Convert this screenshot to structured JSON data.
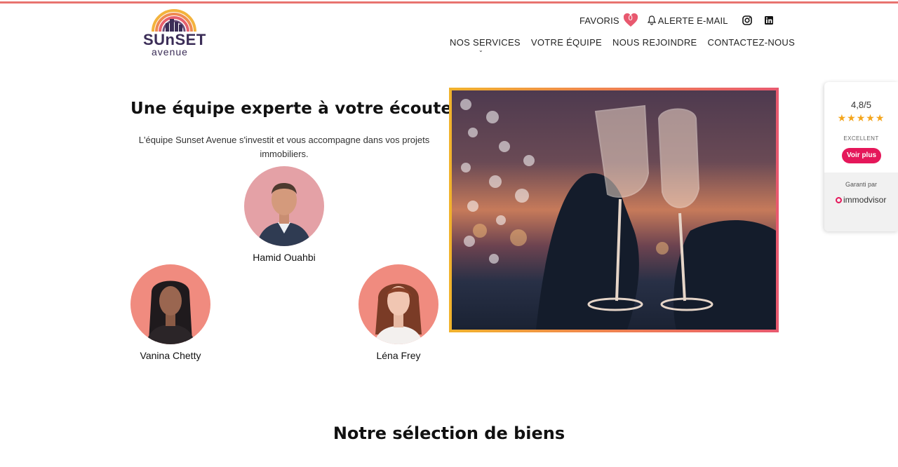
{
  "header": {
    "logo": {
      "line1": "SUnSET",
      "line2": "avenue"
    },
    "utility": {
      "favoris_label": "FAVORIS",
      "favoris_count": "0",
      "alert_label": "ALERTE E-MAIL",
      "social": [
        "instagram-icon",
        "linkedin-icon"
      ]
    },
    "nav": [
      {
        "label": "NOS SERVICES",
        "has_dropdown": true
      },
      {
        "label": "VOTRE ÉQUIPE"
      },
      {
        "label": "NOUS REJOINDRE"
      },
      {
        "label": "CONTACTEZ-NOUS"
      }
    ]
  },
  "hero": {
    "title": "Une équipe experte à votre écoute",
    "description": "L'équipe Sunset Avenue s'investit et vous accompagne dans vos projets immobiliers.",
    "members": [
      {
        "name": "Hamid Ouahbi"
      },
      {
        "name": "Vanina Chetty"
      },
      {
        "name": "Léna Frey"
      }
    ]
  },
  "rating_widget": {
    "score": "4,8/5",
    "stars": "★★★★★",
    "label": "EXCELLENT",
    "button": "Voir plus",
    "guaranteed": "Garanti par",
    "brand": "immodvisor"
  },
  "selection": {
    "title": "Notre sélection de biens"
  },
  "colors": {
    "accent_stripe": "#e8736f",
    "brand_dark": "#3b2d57",
    "pink_button": "#e5175a",
    "star": "#f4a51c"
  }
}
